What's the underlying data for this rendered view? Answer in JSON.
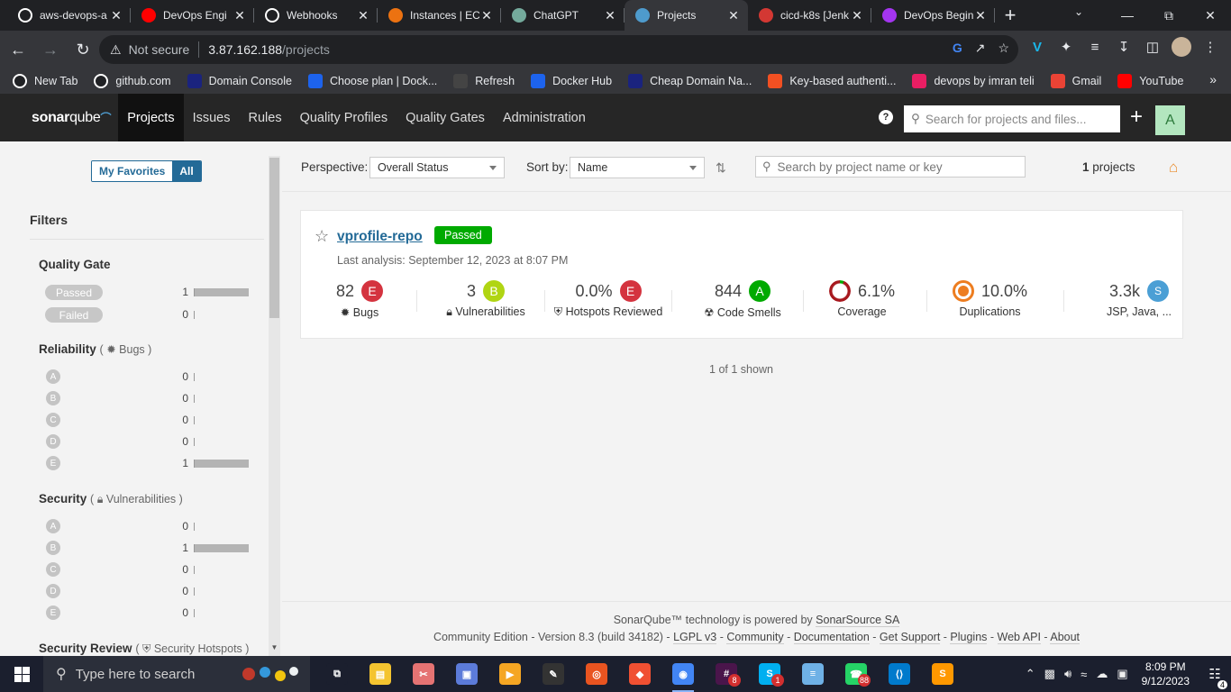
{
  "browser": {
    "tabs": [
      {
        "title": "aws-devops-a",
        "icon": "github-icon",
        "color": "#ffffff"
      },
      {
        "title": "DevOps Engi",
        "icon": "youtube-icon",
        "color": "#ff0000"
      },
      {
        "title": "Webhooks",
        "icon": "github-icon",
        "color": "#ffffff"
      },
      {
        "title": "Instances | EC",
        "icon": "aws-icon",
        "color": "#ec7211"
      },
      {
        "title": "ChatGPT",
        "icon": "chatgpt-icon",
        "color": "#74aa9c"
      },
      {
        "title": "Projects",
        "icon": "sonarqube-icon",
        "color": "#4e9bcd",
        "active": true
      },
      {
        "title": "cicd-k8s [Jenk",
        "icon": "jenkins-icon",
        "color": "#d33833"
      },
      {
        "title": "DevOps Begin",
        "icon": "udemy-icon",
        "color": "#a435f0"
      }
    ],
    "address": {
      "security_label": "Not secure",
      "host": "3.87.162.188",
      "path": "/projects"
    },
    "bookmarks": [
      {
        "label": "New Tab",
        "icon": "github-icon",
        "color": "#202124"
      },
      {
        "label": "github.com",
        "icon": "github-icon",
        "color": "#202124"
      },
      {
        "label": "Domain Console",
        "icon": "domain-icon",
        "color": "#1a237e"
      },
      {
        "label": "Choose plan | Dock...",
        "icon": "docker-icon",
        "color": "#1d63ed"
      },
      {
        "label": "Refresh",
        "icon": "refresh-icon",
        "color": "#444444"
      },
      {
        "label": "Docker Hub",
        "icon": "docker-icon",
        "color": "#1d63ed"
      },
      {
        "label": "Cheap Domain Na...",
        "icon": "namecheap-icon",
        "color": "#1a237e"
      },
      {
        "label": "Key-based authenti...",
        "icon": "microsoft-icon",
        "color": "#f25022"
      },
      {
        "label": "devops by imran teli",
        "icon": "devops-icon",
        "color": "#e91e63"
      },
      {
        "label": "Gmail",
        "icon": "gmail-icon",
        "color": "#ea4335"
      },
      {
        "label": "YouTube",
        "icon": "youtube-icon",
        "color": "#ff0000"
      }
    ]
  },
  "sonar": {
    "logo_main": "sonar",
    "logo_sub": "qube",
    "nav": [
      "Projects",
      "Issues",
      "Rules",
      "Quality Profiles",
      "Quality Gates",
      "Administration"
    ],
    "search_placeholder": "Search for projects and files...",
    "avatar": "A"
  },
  "sidebar": {
    "toggle": {
      "favorites": "My Favorites",
      "all": "All"
    },
    "filters_title": "Filters",
    "quality_gate": {
      "title": "Quality Gate",
      "items": [
        {
          "label": "Passed",
          "count": "1",
          "fraction": 1
        },
        {
          "label": "Failed",
          "count": "0",
          "fraction": 0
        }
      ]
    },
    "reliability": {
      "title": "Reliability",
      "sub": "Bugs",
      "items": [
        {
          "label": "A",
          "count": "0",
          "fraction": 0
        },
        {
          "label": "B",
          "count": "0",
          "fraction": 0
        },
        {
          "label": "C",
          "count": "0",
          "fraction": 0
        },
        {
          "label": "D",
          "count": "0",
          "fraction": 0
        },
        {
          "label": "E",
          "count": "1",
          "fraction": 1
        }
      ]
    },
    "security": {
      "title": "Security",
      "sub": "Vulnerabilities",
      "items": [
        {
          "label": "A",
          "count": "0",
          "fraction": 0
        },
        {
          "label": "B",
          "count": "1",
          "fraction": 1
        },
        {
          "label": "C",
          "count": "0",
          "fraction": 0
        },
        {
          "label": "D",
          "count": "0",
          "fraction": 0
        },
        {
          "label": "E",
          "count": "0",
          "fraction": 0
        }
      ]
    },
    "security_review": {
      "title": "Security Review",
      "sub": "Security Hotspots"
    }
  },
  "main": {
    "perspective_label": "Perspective:",
    "perspective_value": "Overall Status",
    "sort_label": "Sort by:",
    "sort_value": "Name",
    "search_placeholder": "Search by project name or key",
    "count_number": "1",
    "count_label": "projects",
    "project": {
      "name": "vprofile-repo",
      "status": "Passed",
      "last_analysis": "Last analysis: September 12, 2023 at 8:07 PM",
      "measures": {
        "bugs": {
          "value": "82",
          "grade": "E",
          "label": "Bugs",
          "color": "#d4333f"
        },
        "vulnerabilities": {
          "value": "3",
          "grade": "B",
          "label": "Vulnerabilities",
          "color": "#b0d513"
        },
        "hotspots": {
          "value": "0.0%",
          "grade": "E",
          "label": "Hotspots Reviewed",
          "color": "#d4333f"
        },
        "smells": {
          "value": "844",
          "grade": "A",
          "label": "Code Smells",
          "color": "#00aa00"
        },
        "coverage": {
          "value": "6.1%",
          "label": "Coverage",
          "percent": 6.1
        },
        "duplications": {
          "value": "10.0%",
          "label": "Duplications"
        },
        "size": {
          "value": "3.3k",
          "grade": "S",
          "label": "JSP, Java, ..."
        }
      }
    },
    "shown": "1 of 1 shown",
    "footer": {
      "line1_text": "SonarQube™ technology is powered by",
      "line1_link": "SonarSource SA",
      "edition": "Community Edition - Version 8.3 (build 34182) -",
      "links": [
        "LGPL v3",
        "Community",
        "Documentation",
        "Get Support",
        "Plugins",
        "Web API",
        "About"
      ]
    }
  },
  "taskbar": {
    "search_placeholder": "Type here to search",
    "apps": [
      {
        "name": "task-view-icon",
        "color": "#1b1f2e"
      },
      {
        "name": "file-explorer-icon",
        "color": "#f4c430"
      },
      {
        "name": "snipping-icon",
        "color": "#e57373"
      },
      {
        "name": "photos-icon",
        "color": "#5c7bd9"
      },
      {
        "name": "media-player-icon",
        "color": "#f5a623"
      },
      {
        "name": "paint-icon",
        "color": "#333333"
      },
      {
        "name": "ubuntu-icon",
        "color": "#e95420"
      },
      {
        "name": "git-icon",
        "color": "#f05032"
      },
      {
        "name": "chrome-icon",
        "color": "#4285f4",
        "running": true
      },
      {
        "name": "slack-icon",
        "color": "#4a154b",
        "badge": "8"
      },
      {
        "name": "skype-icon",
        "color": "#00aff0",
        "badge": "1"
      },
      {
        "name": "notepad-icon",
        "color": "#6fb1e6"
      },
      {
        "name": "whatsapp-icon",
        "color": "#25d366",
        "badge": "88"
      },
      {
        "name": "vscode-icon",
        "color": "#007acc"
      },
      {
        "name": "sublime-icon",
        "color": "#ff9800"
      }
    ],
    "time": "8:09 PM",
    "date": "9/12/2023",
    "notifications": "4"
  }
}
